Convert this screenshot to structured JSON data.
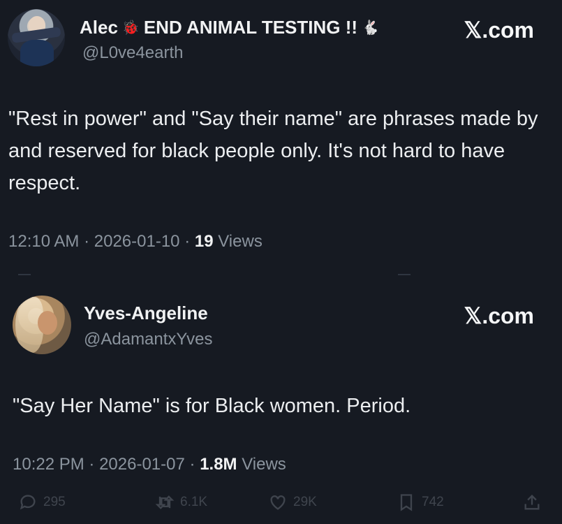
{
  "tweets": [
    {
      "display_name": "Alec",
      "emoji_1": "🐞",
      "name_suffix": "END ANIMAL TESTING !!",
      "emoji_2": "🐇",
      "handle": "@L0ve4earth",
      "brand": "𝕏.com",
      "text": "\"Rest in power\" and \"Say their name\" are phrases made by and reserved for black people only. It's not hard to have respect.",
      "time": "12:10 AM",
      "date": "2026-01-10",
      "views_count": "19",
      "views_label": "Views"
    },
    {
      "display_name": "Yves-Angeline",
      "handle": "@AdamantxYves",
      "brand": "𝕏.com",
      "text": "\"Say Her Name\" is for Black women. Period.",
      "time": "10:22 PM",
      "date": "2026-01-07",
      "views_count": "1.8M",
      "views_label": "Views",
      "actions": {
        "replies": "295",
        "reposts": "6.1K",
        "likes": "29K",
        "bookmarks": "742"
      }
    }
  ],
  "separator": "·",
  "icons": [
    "reply-icon",
    "repost-icon",
    "like-icon",
    "bookmark-icon",
    "share-icon"
  ],
  "colors": {
    "background": "#161a22",
    "text": "#eceef0",
    "muted": "#8b949e"
  }
}
